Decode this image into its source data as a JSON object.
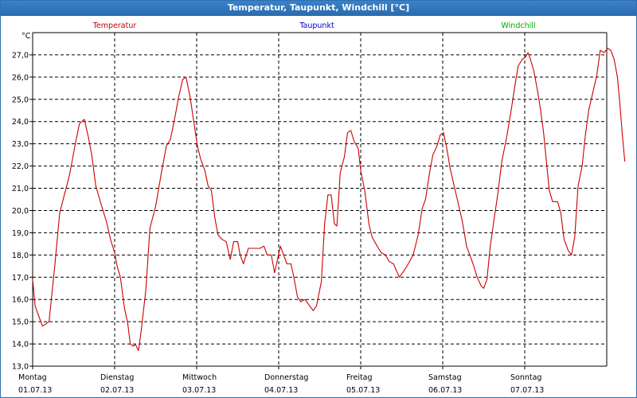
{
  "window": {
    "title": "Temperatur, Taupunkt, Windchill [°C]"
  },
  "chart_data": {
    "type": "line",
    "title": "Temperatur, Taupunkt, Windchill [°C]",
    "ylabel": "°C",
    "ylim": [
      13.0,
      28.0
    ],
    "yticks": [
      "13,0",
      "14,0",
      "15,0",
      "16,0",
      "17,0",
      "18,0",
      "19,0",
      "20,0",
      "21,0",
      "22,0",
      "23,0",
      "24,0",
      "25,0",
      "26,0",
      "27,0"
    ],
    "xlim": [
      0,
      7
    ],
    "days": [
      {
        "weekday": "Montag",
        "date": "01.07.13"
      },
      {
        "weekday": "Dienstag",
        "date": "02.07.13"
      },
      {
        "weekday": "Mittwoch",
        "date": "03.07.13"
      },
      {
        "weekday": "Donnerstag",
        "date": "04.07.13"
      },
      {
        "weekday": "Freitag",
        "date": "05.07.13"
      },
      {
        "weekday": "Samstag",
        "date": "06.07.13"
      },
      {
        "weekday": "Sonntag",
        "date": "07.07.13"
      }
    ],
    "grid": true,
    "legend_placement": "top",
    "series": [
      {
        "name": "Temperatur",
        "color": "#cc0000",
        "points": [
          [
            0.0,
            16.9
          ],
          [
            0.03,
            15.7
          ],
          [
            0.08,
            15.2
          ],
          [
            0.12,
            14.8
          ],
          [
            0.2,
            15.0
          ],
          [
            0.27,
            17.5
          ],
          [
            0.33,
            19.9
          ],
          [
            0.45,
            21.6
          ],
          [
            0.52,
            23.0
          ],
          [
            0.57,
            23.9
          ],
          [
            0.63,
            24.1
          ],
          [
            0.68,
            23.3
          ],
          [
            0.72,
            22.5
          ],
          [
            0.77,
            21.1
          ],
          [
            0.85,
            20.1
          ],
          [
            0.9,
            19.5
          ],
          [
            0.95,
            18.7
          ],
          [
            1.0,
            18.1
          ],
          [
            1.03,
            17.5
          ],
          [
            1.07,
            17.0
          ],
          [
            1.12,
            15.6
          ],
          [
            1.16,
            14.9
          ],
          [
            1.19,
            14.0
          ],
          [
            1.23,
            13.9
          ],
          [
            1.25,
            14.0
          ],
          [
            1.29,
            13.7
          ],
          [
            1.32,
            14.5
          ],
          [
            1.38,
            16.4
          ],
          [
            1.43,
            19.2
          ],
          [
            1.5,
            20.2
          ],
          [
            1.57,
            21.7
          ],
          [
            1.63,
            22.9
          ],
          [
            1.68,
            23.2
          ],
          [
            1.73,
            24.1
          ],
          [
            1.78,
            25.1
          ],
          [
            1.83,
            25.9
          ],
          [
            1.87,
            26.0
          ],
          [
            1.92,
            25.1
          ],
          [
            1.96,
            24.1
          ],
          [
            2.01,
            22.9
          ],
          [
            2.05,
            22.3
          ],
          [
            2.1,
            21.8
          ],
          [
            2.14,
            21.1
          ],
          [
            2.18,
            20.9
          ],
          [
            2.22,
            19.7
          ],
          [
            2.26,
            18.9
          ],
          [
            2.31,
            18.7
          ],
          [
            2.36,
            18.6
          ],
          [
            2.41,
            17.8
          ],
          [
            2.45,
            18.6
          ],
          [
            2.5,
            18.6
          ],
          [
            2.53,
            18.0
          ],
          [
            2.57,
            17.6
          ],
          [
            2.63,
            18.3
          ],
          [
            2.7,
            18.3
          ],
          [
            2.77,
            18.3
          ],
          [
            2.82,
            18.4
          ],
          [
            2.86,
            18.0
          ],
          [
            2.91,
            18.0
          ],
          [
            2.95,
            17.2
          ],
          [
            3.02,
            18.4
          ],
          [
            3.06,
            18.0
          ],
          [
            3.1,
            17.6
          ],
          [
            3.15,
            17.6
          ],
          [
            3.18,
            17.1
          ],
          [
            3.23,
            16.1
          ],
          [
            3.27,
            15.9
          ],
          [
            3.32,
            16.0
          ],
          [
            3.38,
            15.7
          ],
          [
            3.42,
            15.5
          ],
          [
            3.46,
            15.7
          ],
          [
            3.52,
            16.8
          ],
          [
            3.56,
            19.4
          ],
          [
            3.6,
            20.7
          ],
          [
            3.64,
            20.7
          ],
          [
            3.68,
            19.4
          ],
          [
            3.71,
            19.3
          ],
          [
            3.75,
            21.7
          ],
          [
            3.8,
            22.4
          ],
          [
            3.84,
            23.5
          ],
          [
            3.88,
            23.6
          ],
          [
            3.92,
            23.1
          ],
          [
            3.97,
            22.8
          ],
          [
            4.0,
            21.8
          ],
          [
            4.05,
            20.9
          ],
          [
            4.1,
            19.4
          ],
          [
            4.14,
            18.8
          ],
          [
            4.2,
            18.4
          ],
          [
            4.25,
            18.1
          ],
          [
            4.3,
            18.0
          ],
          [
            4.35,
            17.7
          ],
          [
            4.4,
            17.6
          ],
          [
            4.47,
            17.0
          ],
          [
            4.53,
            17.3
          ],
          [
            4.58,
            17.6
          ],
          [
            4.64,
            18.0
          ],
          [
            4.7,
            18.9
          ],
          [
            4.75,
            20.1
          ],
          [
            4.79,
            20.5
          ],
          [
            4.84,
            21.7
          ],
          [
            4.88,
            22.5
          ],
          [
            4.93,
            22.9
          ],
          [
            4.97,
            23.4
          ],
          [
            5.01,
            23.5
          ],
          [
            5.05,
            22.8
          ],
          [
            5.09,
            21.9
          ],
          [
            5.14,
            21.1
          ],
          [
            5.19,
            20.3
          ],
          [
            5.24,
            19.5
          ],
          [
            5.29,
            18.4
          ],
          [
            5.33,
            18.0
          ],
          [
            5.37,
            17.6
          ],
          [
            5.42,
            17.0
          ],
          [
            5.47,
            16.6
          ],
          [
            5.5,
            16.5
          ],
          [
            5.54,
            16.9
          ],
          [
            5.58,
            18.4
          ],
          [
            5.63,
            19.7
          ],
          [
            5.67,
            20.7
          ],
          [
            5.72,
            22.2
          ],
          [
            5.78,
            23.3
          ],
          [
            5.83,
            24.4
          ],
          [
            5.88,
            25.6
          ],
          [
            5.92,
            26.5
          ],
          [
            5.97,
            26.8
          ],
          [
            6.01,
            26.9
          ],
          [
            6.04,
            27.1
          ],
          [
            6.07,
            26.8
          ],
          [
            6.11,
            26.3
          ],
          [
            6.15,
            25.5
          ],
          [
            6.19,
            24.6
          ],
          [
            6.23,
            23.5
          ],
          [
            6.27,
            22.0
          ],
          [
            6.3,
            20.9
          ],
          [
            6.34,
            20.4
          ],
          [
            6.4,
            20.4
          ],
          [
            6.44,
            19.9
          ],
          [
            6.48,
            18.7
          ],
          [
            6.53,
            18.2
          ],
          [
            6.57,
            18.0
          ],
          [
            6.61,
            18.8
          ],
          [
            6.65,
            21.1
          ],
          [
            6.7,
            22.0
          ],
          [
            6.74,
            23.4
          ],
          [
            6.78,
            24.5
          ],
          [
            6.83,
            25.3
          ],
          [
            6.88,
            26.1
          ],
          [
            6.92,
            27.2
          ],
          [
            6.97,
            27.1
          ],
          [
            7.01,
            27.3
          ],
          [
            7.05,
            27.2
          ],
          [
            7.09,
            26.8
          ],
          [
            7.13,
            26.0
          ],
          [
            7.16,
            24.8
          ],
          [
            7.19,
            23.4
          ],
          [
            7.22,
            22.2
          ]
        ]
      },
      {
        "name": "Taupunkt",
        "color": "#0000cc",
        "points": []
      },
      {
        "name": "Windchill",
        "color": "#00aa00",
        "points": []
      }
    ]
  }
}
